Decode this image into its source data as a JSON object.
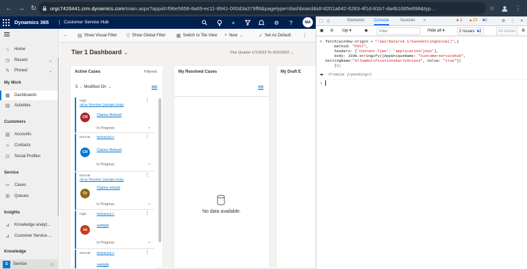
{
  "browser": {
    "url_host": "orgc7426441.crm.dynamics.com",
    "url_rest": "/main.aspx?appid=f96e5858-8a69-ec11-8941-000d3a379ff8&pagetype=dashboard&id=d201a642-6283-4f1d-81b7-da4b1685e698&typ..."
  },
  "app": {
    "brand": "Dynamics 365",
    "title": "Customer Service Hub",
    "avatar": "MA"
  },
  "nav": {
    "items_top": [
      {
        "label": "Home",
        "icon": "home-icon"
      },
      {
        "label": "Recent",
        "icon": "clock-icon",
        "chevron": "⌄"
      },
      {
        "label": "Pinned",
        "icon": "pin-icon",
        "chevron": "⌄"
      }
    ],
    "sections": [
      {
        "title": "My Work",
        "items": [
          {
            "label": "Dashboards",
            "active": true
          },
          {
            "label": "Activities"
          }
        ]
      },
      {
        "title": "Customers",
        "items": [
          {
            "label": "Accounts"
          },
          {
            "label": "Contacts"
          },
          {
            "label": "Social Profiles"
          }
        ]
      },
      {
        "title": "Service",
        "items": [
          {
            "label": "Cases"
          },
          {
            "label": "Queues"
          }
        ]
      },
      {
        "title": "Insights",
        "items": [
          {
            "label": "Knowledge analyt..."
          },
          {
            "label": "Customer Service ..."
          }
        ]
      },
      {
        "title": "Knowledge",
        "items": []
      }
    ],
    "area": {
      "badge": "S",
      "label": "Service"
    }
  },
  "commands": {
    "visual_filter": "Show Visual Filter",
    "global_filter": "Show Global Filter",
    "tile_view": "Switch to Tile View",
    "new": "New",
    "set_default": "Set As Default"
  },
  "dashboard": {
    "title": "Tier 1 Dashboard",
    "period": "This Quarter 1/1/2022 To 3/31/2022",
    "panels": {
      "active": {
        "title": "Active Cases",
        "badge": "Filtered",
        "sort_num": "5",
        "sort_by": "Modified On"
      },
      "resolved": {
        "title": "My Resolved Cases",
        "empty": "No data available."
      },
      "drafts": {
        "title": "My Draft E"
      }
    },
    "cases": [
      {
        "priority": "High",
        "customer": "Alicia Thomber (Sample Data)",
        "avatar": "CR",
        "avatar_color": "#a4262c",
        "subject": "Claims Refund",
        "status": "In Progress"
      },
      {
        "priority": "Normal",
        "customer": "Mohamed A",
        "avatar": "CR",
        "avatar_color": "#0078d4",
        "subject": "Claims Refund",
        "status": "In Progress"
      },
      {
        "priority": "Normal",
        "customer": "Alicia Thomber (Sample Data)",
        "avatar": "Cr",
        "avatar_color": "#8f6a11",
        "subject": "Claims refund",
        "status": "In Progress"
      },
      {
        "priority": "High",
        "customer": "Mohamed A",
        "avatar": "sa",
        "avatar_color": "#c43e1c",
        "subject": "sample",
        "status": "In Progress"
      },
      {
        "priority": "Normal",
        "customer": "Mohamed A",
        "avatar": "",
        "avatar_color": "#0078d4",
        "subject": "sample",
        "status": ""
      }
    ]
  },
  "devtools": {
    "tabs": [
      "Elements",
      "Console",
      "Sources",
      "»"
    ],
    "errors": "1",
    "warnings": "23",
    "messages": "2",
    "context": "top",
    "filter_placeholder": "Filter",
    "levels": "Hide all",
    "issues": "2 Issues: ",
    "issues_count": "2",
    "hidden": "All hidden",
    "console": {
      "line1a": "fetch(window.origin + ",
      "line1b": "\"/api/data/v9.1/SaveSettingValue()\"",
      "line1c": ",{",
      "line2a": "    method: ",
      "line2b": "\"POST\"",
      "line2c": ",",
      "line3a": "    headers: {",
      "line3b": "'Content-Type'",
      "line3c": ": ",
      "line3d": "'application/json'",
      "line3e": "},",
      "line4a": "    body: JSON.stringify({AppUniqueName: ",
      "line4b": "\"Customerservicehub\"",
      "line4c": ",",
      "line5a": "SettingName:",
      "line5b": "\"AllowNotificationsEarlyAccess\"",
      "line5c": ", Value: ",
      "line5d": "\"true\"",
      "line5e": "})",
      "line6": "    });",
      "result_keyword": "Promise",
      "result_state": "{<pending>}"
    }
  }
}
